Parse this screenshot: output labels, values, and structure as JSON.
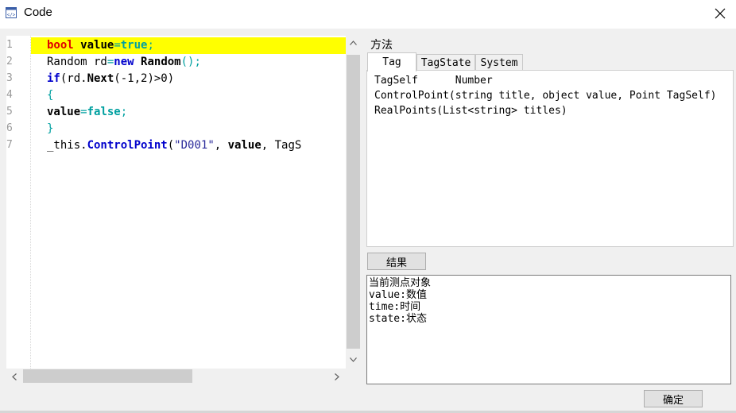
{
  "window": {
    "title": "Code",
    "icon": "code-window-icon",
    "close_icon": "close-icon"
  },
  "editor": {
    "line_numbers": [
      "1",
      "2",
      "3",
      "4",
      "5",
      "6",
      "7"
    ],
    "lines": [
      {
        "parts": [
          {
            "t": "bool",
            "c": "k-red"
          },
          {
            "t": " ",
            "c": ""
          },
          {
            "t": "value",
            "c": "b"
          },
          {
            "t": "=",
            "c": "k-teal"
          },
          {
            "t": "true",
            "c": "k-teal b"
          },
          {
            "t": ";",
            "c": "k-teal"
          }
        ],
        "highlight": true
      },
      {
        "parts": [
          {
            "t": "Random rd",
            "c": ""
          },
          {
            "t": "=",
            "c": "k-teal"
          },
          {
            "t": "new",
            "c": "k-blue"
          },
          {
            "t": " ",
            "c": ""
          },
          {
            "t": "Random",
            "c": "b"
          },
          {
            "t": "();",
            "c": "k-teal"
          }
        ],
        "highlight": false
      },
      {
        "parts": [
          {
            "t": "if",
            "c": "k-blue"
          },
          {
            "t": "(rd.",
            "c": ""
          },
          {
            "t": "Next",
            "c": "b"
          },
          {
            "t": "(-1,2)>0)",
            "c": ""
          }
        ],
        "highlight": false
      },
      {
        "parts": [
          {
            "t": "{",
            "c": "k-teal"
          }
        ],
        "highlight": false
      },
      {
        "parts": [
          {
            "t": "value",
            "c": "b"
          },
          {
            "t": "=",
            "c": "k-teal"
          },
          {
            "t": "false",
            "c": "k-teal b"
          },
          {
            "t": ";",
            "c": "k-teal"
          }
        ],
        "highlight": false
      },
      {
        "parts": [
          {
            "t": "}",
            "c": "k-teal"
          }
        ],
        "highlight": false
      },
      {
        "parts": [
          {
            "t": "_this.",
            "c": ""
          },
          {
            "t": "ControlPoint",
            "c": "k-blue"
          },
          {
            "t": "(",
            "c": ""
          },
          {
            "t": "\"D001\"",
            "c": "str"
          },
          {
            "t": ", ",
            "c": ""
          },
          {
            "t": "value",
            "c": "b"
          },
          {
            "t": ", TagS",
            "c": ""
          }
        ],
        "highlight": false
      }
    ],
    "highlight_color": "#ffff00"
  },
  "methods": {
    "label": "方法",
    "tabs": [
      {
        "label": "Tag",
        "active": true
      },
      {
        "label": "TagState",
        "active": false
      },
      {
        "label": "System",
        "active": false
      }
    ],
    "items": [
      "TagSelf      Number",
      "ControlPoint(string title, object value, Point TagSelf)",
      "RealPoints(List<string> titles)"
    ]
  },
  "result": {
    "button_label": "结果",
    "lines": [
      "当前测点对象",
      "value:数值",
      "time:时间",
      "state:状态"
    ]
  },
  "footer": {
    "ok_label": "确定"
  }
}
